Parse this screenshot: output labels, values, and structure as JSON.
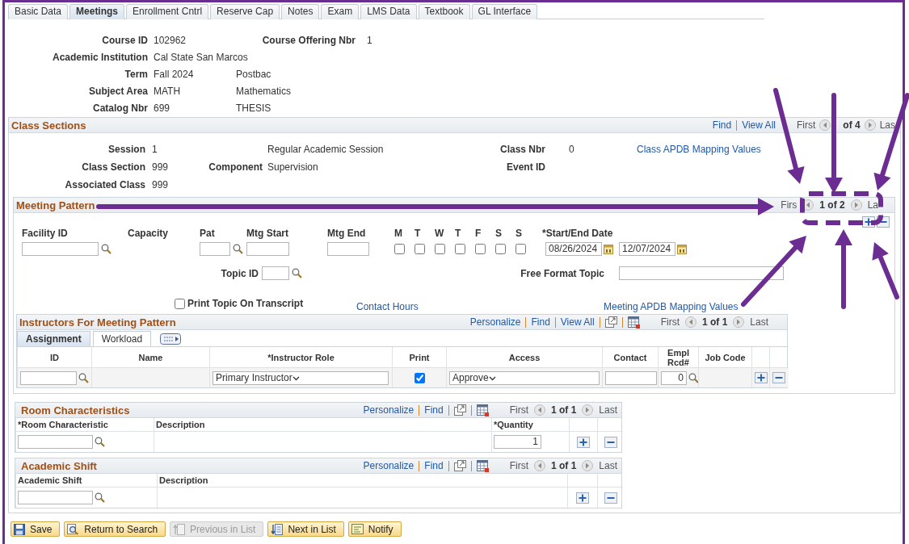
{
  "tabs": [
    {
      "label": "Basic Data",
      "selected": false
    },
    {
      "label": "Meetings",
      "selected": true
    },
    {
      "label": "Enrollment Cntrl",
      "selected": false
    },
    {
      "label": "Reserve Cap",
      "selected": false
    },
    {
      "label": "Notes",
      "selected": false
    },
    {
      "label": "Exam",
      "selected": false
    },
    {
      "label": "LMS Data",
      "selected": false
    },
    {
      "label": "Textbook",
      "selected": false
    },
    {
      "label": "GL Interface",
      "selected": false
    }
  ],
  "course": [
    {
      "label": "Course ID",
      "value": "102962",
      "label_2": "Course Offering Nbr",
      "value_2": "1"
    },
    {
      "label": "Academic Institution",
      "value": "Cal State San Marcos"
    },
    {
      "label": "Term",
      "value": "Fall 2024",
      "description": "Postbac"
    },
    {
      "label": "Subject Area",
      "value": "MATH",
      "description": "Mathematics"
    },
    {
      "label": "Catalog Nbr",
      "value": "699",
      "description": "THESIS"
    }
  ],
  "class_sections": {
    "title": "Class Sections",
    "nav": {
      "find": "Find",
      "view_all": "View All",
      "first": "First",
      "count": "of 4",
      "last": "Las"
    },
    "session_label": "Session",
    "session": "1",
    "session_desc": "Regular Academic Session",
    "class_nbr_label": "Class Nbr",
    "class_nbr": "0",
    "mapping_link": "Class APDB Mapping Values",
    "section_label": "Class Section",
    "section": "999",
    "component_label": "Component",
    "component": "Supervision",
    "event_label": "Event ID",
    "associated_label": "Associated Class",
    "associated": "999"
  },
  "meeting_pattern": {
    "title": "Meeting Pattern",
    "nav": {
      "first": "Firs",
      "count": "1 of 2",
      "last": "La"
    },
    "facility_label": "Facility ID",
    "capacity_label": "Capacity",
    "pat_label": "Pat",
    "start_label": "Mtg Start",
    "end_label": "Mtg End",
    "days": [
      {
        "label": "M",
        "checked": false
      },
      {
        "label": "T",
        "checked": false
      },
      {
        "label": "W",
        "checked": false
      },
      {
        "label": "T",
        "checked": false
      },
      {
        "label": "F",
        "checked": false
      },
      {
        "label": "S",
        "checked": false
      },
      {
        "label": "S",
        "checked": false
      }
    ],
    "date_label": "*Start/End Date",
    "start_date": "08/26/2024",
    "end_date": "12/07/2024",
    "topic_label": "Topic ID",
    "free_topic_label": "Free Format Topic",
    "print_topic": {
      "label": "Print Topic On Transcript",
      "checked": false
    },
    "contact_hours_link": "Contact Hours",
    "mapping_link": "Meeting APDB Mapping Values"
  },
  "instructors": {
    "title": "Instructors For Meeting Pattern",
    "toolbar": {
      "personalize": "Personalize",
      "find": "Find",
      "view_all": "View All",
      "first": "First",
      "count": "1 of 1",
      "last": "Last"
    },
    "subtabs": [
      {
        "label": "Assignment",
        "selected": true
      },
      {
        "label": "Workload",
        "selected": false
      }
    ],
    "columns": [
      "ID",
      "Name",
      "*Instructor Role",
      "Print",
      "Access",
      "Contact",
      "Empl Rcd#",
      "Job Code"
    ],
    "row": {
      "role": "Primary Instructor",
      "print": true,
      "access": "Approve",
      "empl_rcd": "0"
    }
  },
  "room_characteristics": {
    "title": "Room Characteristics",
    "toolbar": {
      "personalize": "Personalize",
      "find": "Find",
      "first": "First",
      "count": "1 of 1",
      "last": "Last"
    },
    "columns": [
      "*Room Characteristic",
      "Description",
      "*Quantity"
    ],
    "row": {
      "quantity": "1"
    }
  },
  "academic_shift": {
    "title": "Academic Shift",
    "toolbar": {
      "personalize": "Personalize",
      "find": "Find",
      "first": "First",
      "count": "1 of 1",
      "last": "Last"
    },
    "columns": [
      "Academic Shift",
      "Description"
    ]
  },
  "buttons": [
    {
      "label": "Save",
      "kind": "save",
      "disabled": false
    },
    {
      "label": "Return to Search",
      "kind": "search",
      "disabled": false
    },
    {
      "label": "Previous in List",
      "kind": "previous",
      "disabled": true
    },
    {
      "label": "Next in List",
      "kind": "next",
      "disabled": false
    },
    {
      "label": "Notify",
      "kind": "notify",
      "disabled": false
    }
  ]
}
